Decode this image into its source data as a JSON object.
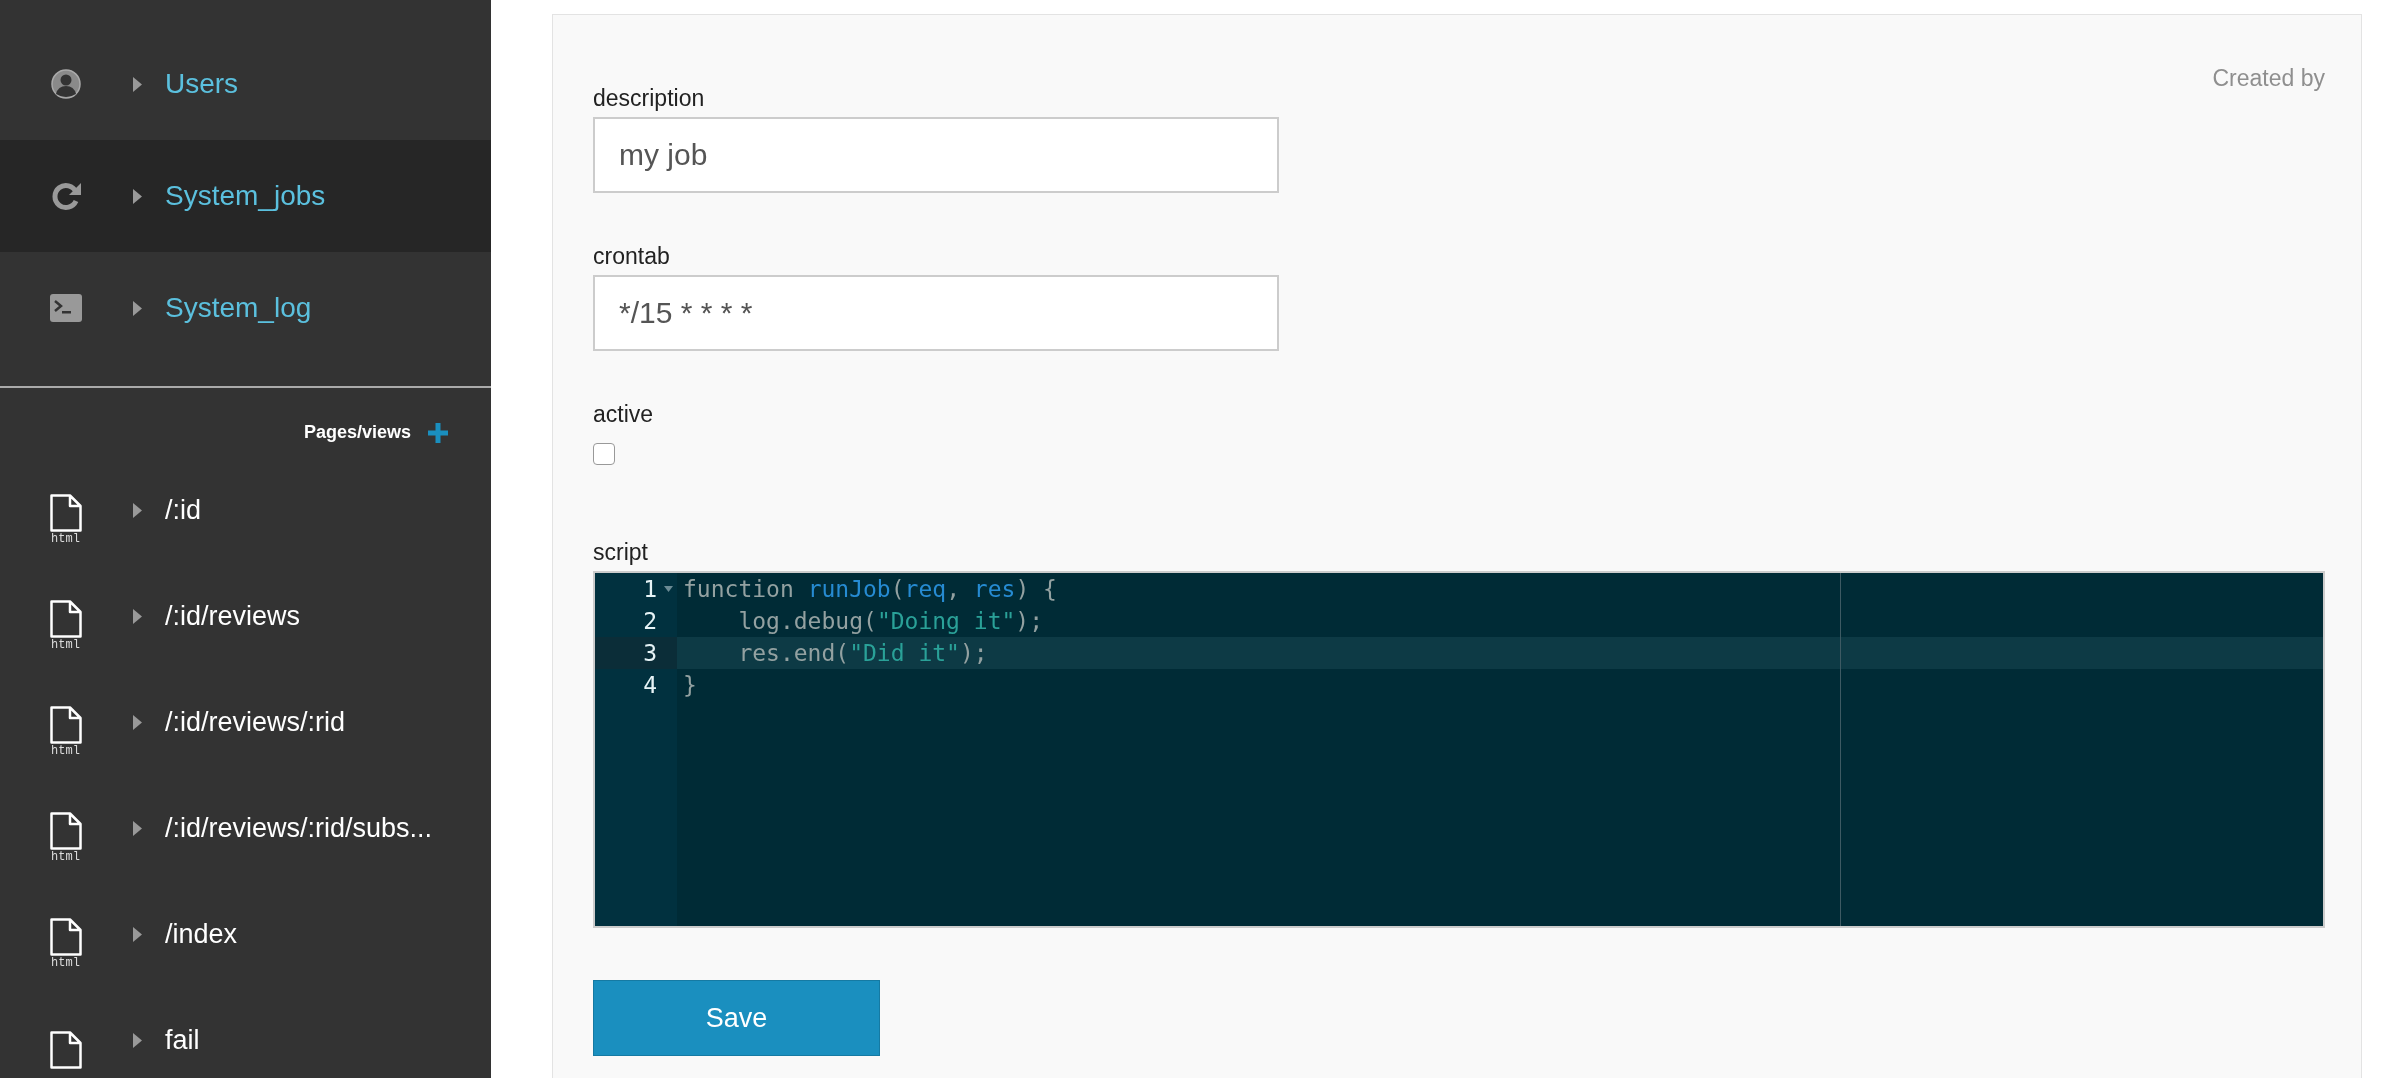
{
  "sidebar": {
    "nav_items": [
      {
        "label": "Users",
        "kind": "user",
        "selected": false
      },
      {
        "label": "System_jobs",
        "kind": "refresh",
        "selected": true
      },
      {
        "label": "System_log",
        "kind": "terminal",
        "selected": false
      }
    ],
    "pages_header": {
      "label": "Pages/views"
    },
    "pages": [
      {
        "label": "/:id",
        "icon_label": "html"
      },
      {
        "label": "/:id/reviews",
        "icon_label": "html"
      },
      {
        "label": "/:id/reviews/:rid",
        "icon_label": "html"
      },
      {
        "label": "/:id/reviews/:rid/subs...",
        "icon_label": "html"
      },
      {
        "label": "/index",
        "icon_label": "html"
      },
      {
        "label": "fail"
      }
    ]
  },
  "form": {
    "created_by": "Created by",
    "fields": [
      {
        "kind": "text",
        "label": "description",
        "value": "my job"
      },
      {
        "kind": "text",
        "label": "crontab",
        "value": "*/15 * * * *"
      },
      {
        "kind": "checkbox",
        "label": "active",
        "checked": false
      },
      {
        "kind": "code",
        "label": "script",
        "lines": [
          {
            "number": "1",
            "foldable": true,
            "active": false,
            "tokens": [
              {
                "kind": "plain",
                "text": "function "
              },
              {
                "kind": "name",
                "text": "runJob"
              },
              {
                "kind": "plain",
                "text": "("
              },
              {
                "kind": "name",
                "text": "req"
              },
              {
                "kind": "plain",
                "text": ", "
              },
              {
                "kind": "name",
                "text": "res"
              },
              {
                "kind": "plain",
                "text": ") {"
              }
            ]
          },
          {
            "number": "2",
            "foldable": false,
            "active": false,
            "tokens": [
              {
                "kind": "plain",
                "text": "    log.debug("
              },
              {
                "kind": "string",
                "text": "\"Doing it\""
              },
              {
                "kind": "plain",
                "text": ");"
              }
            ]
          },
          {
            "number": "3",
            "foldable": false,
            "active": true,
            "tokens": [
              {
                "kind": "plain",
                "text": "    res.end("
              },
              {
                "kind": "string",
                "text": "\"Did it\""
              },
              {
                "kind": "plain",
                "text": ");"
              }
            ]
          },
          {
            "number": "4",
            "foldable": false,
            "active": false,
            "tokens": [
              {
                "kind": "plain",
                "text": "}"
              }
            ]
          }
        ]
      }
    ],
    "save_button": "Save"
  }
}
